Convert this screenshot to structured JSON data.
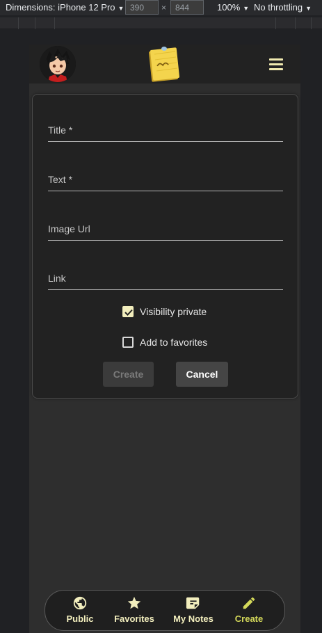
{
  "devtools": {
    "device": "Dimensions: iPhone 12 Pro",
    "width": "390",
    "times": "×",
    "height": "844",
    "zoom": "100%",
    "throttle": "No throttling",
    "caret": "▼"
  },
  "form": {
    "title_placeholder": "Title *",
    "text_placeholder": "Text *",
    "image_placeholder": "Image Url",
    "link_placeholder": "Link",
    "visibility_label": "Visibility private",
    "visibility_checked": true,
    "favorites_label": "Add to favorites",
    "favorites_checked": false,
    "create_label": "Create",
    "cancel_label": "Cancel"
  },
  "nav": [
    {
      "label": "Public",
      "icon": "globe-icon",
      "active": false
    },
    {
      "label": "Favorites",
      "icon": "star-icon",
      "active": false
    },
    {
      "label": "My Notes",
      "icon": "note-icon",
      "active": false
    },
    {
      "label": "Create",
      "icon": "pencil-icon",
      "active": true
    }
  ],
  "colors": {
    "accent": "#d4d95a",
    "nav_text": "#f2eebd",
    "header_bg": "#222222",
    "page_bg": "#2e2e2e"
  }
}
